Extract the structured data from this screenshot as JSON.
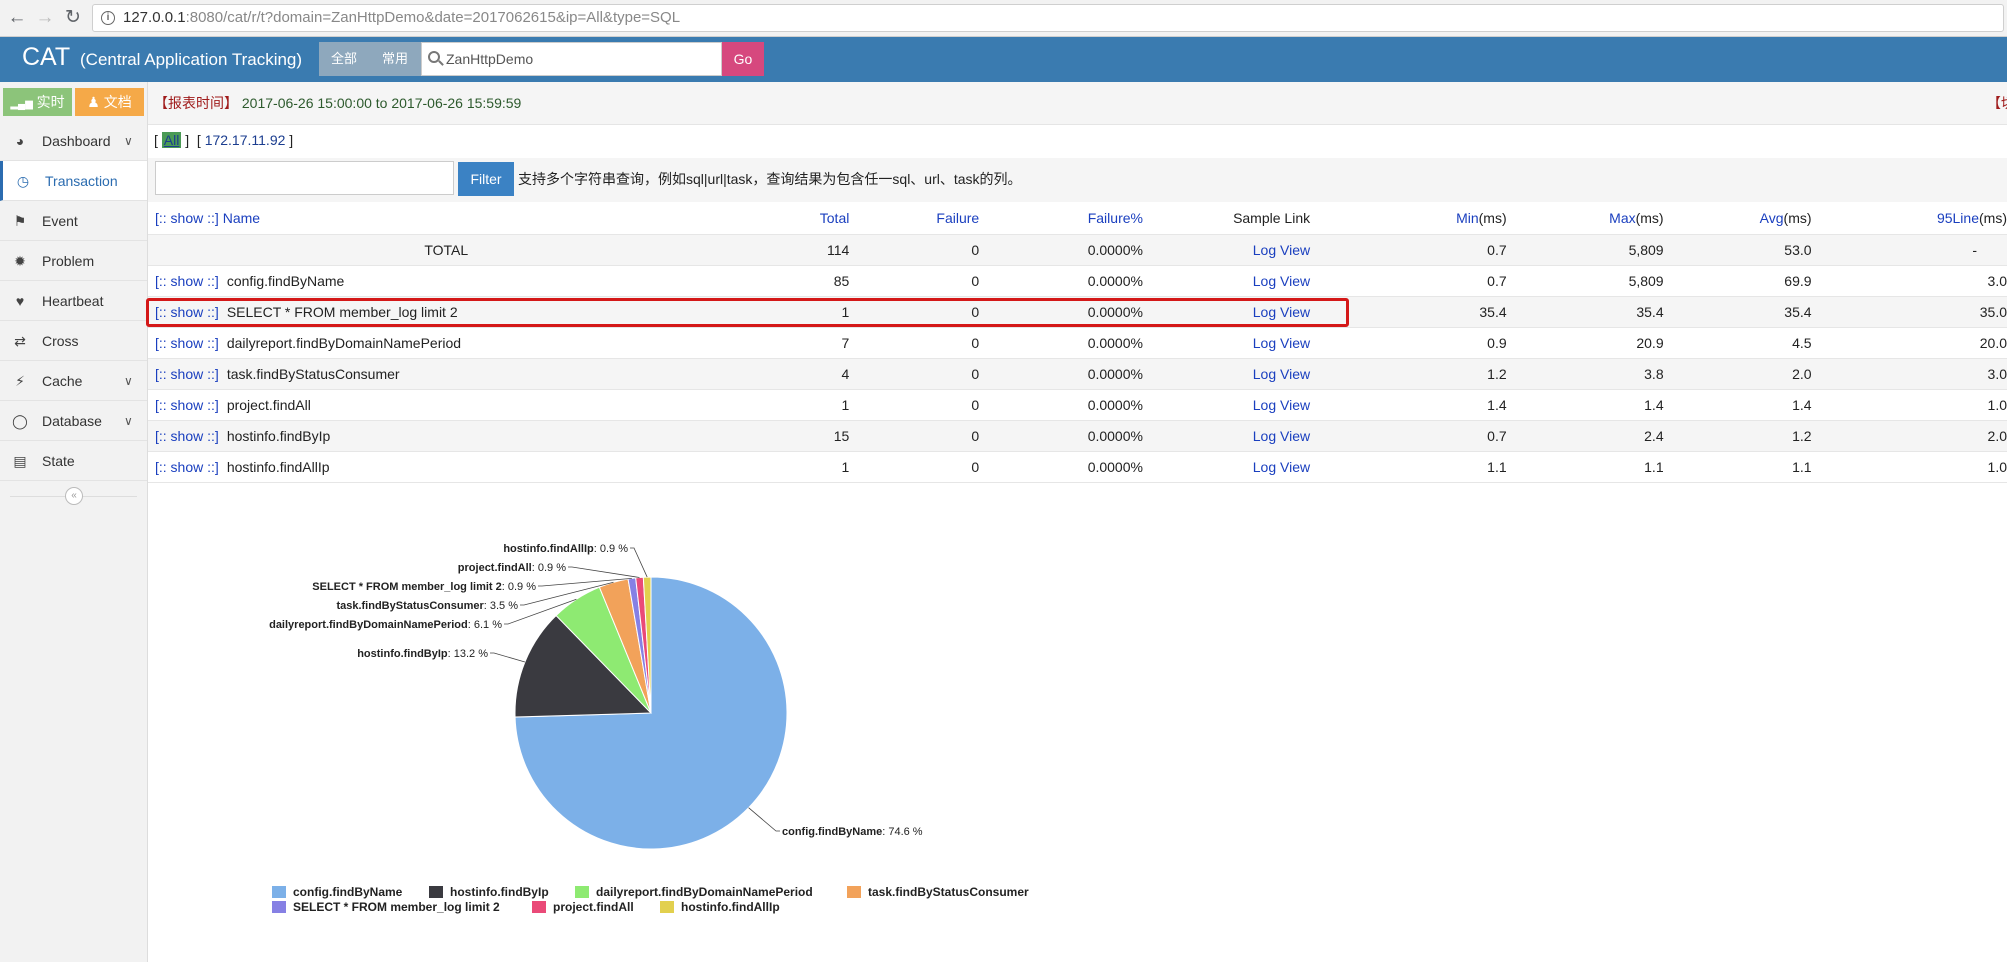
{
  "browser": {
    "url_host": "127.0.0.1",
    "url_rest": ":8080/cat/r/t?domain=ZanHttpDemo&date=2017062615&ip=All&type=SQL"
  },
  "header": {
    "brand": "CAT",
    "brand_sub": "(Central Application Tracking)",
    "tab_all": "全部",
    "tab_common": "常用",
    "search_value": "ZanHttpDemo",
    "go_label": "Go"
  },
  "sidebar": {
    "realtime_label": "实时",
    "docs_label": "文档",
    "items": [
      {
        "label": "Dashboard",
        "icon": "tachometer-icon",
        "has_chevron": true
      },
      {
        "label": "Transaction",
        "icon": "clock-icon",
        "active": true
      },
      {
        "label": "Event",
        "icon": "flag-icon"
      },
      {
        "label": "Problem",
        "icon": "bug-icon"
      },
      {
        "label": "Heartbeat",
        "icon": "heart-icon"
      },
      {
        "label": "Cross",
        "icon": "shuffle-icon"
      },
      {
        "label": "Cache",
        "icon": "bolt-icon",
        "has_chevron": true
      },
      {
        "label": "Database",
        "icon": "database-icon",
        "has_chevron": true
      },
      {
        "label": "State",
        "icon": "bar-chart-icon"
      }
    ]
  },
  "report": {
    "time_label": "【报表时间】",
    "time_range": "2017-06-26 15:00:00 to 2017-06-26 15:59:59",
    "switch_label": "【切"
  },
  "ip_filter": {
    "all": "All",
    "ip": "172.17.11.92"
  },
  "filter": {
    "button": "Filter",
    "hint": "支持多个字符串查询，例如sql|url|task，查询结果为包含任一sql、url、task的列。"
  },
  "table": {
    "headers": {
      "show": "[:: show ::]",
      "name": "Name",
      "total": "Total",
      "failure": "Failure",
      "failure_pct": "Failure%",
      "sample_link": "Sample Link",
      "min": "Min",
      "max": "Max",
      "avg": "Avg",
      "line95": "95Line",
      "unit": "(ms)"
    },
    "total_row": {
      "name": "TOTAL",
      "total": "114",
      "failure": "0",
      "failure_pct": "0.0000%",
      "link": "Log View",
      "min": "0.7",
      "max": "5,809",
      "avg": "53.0",
      "line95": "-"
    },
    "rows": [
      {
        "show": "[:: show ::]",
        "name": "config.findByName",
        "total": "85",
        "failure": "0",
        "failure_pct": "0.0000%",
        "link": "Log View",
        "min": "0.7",
        "max": "5,809",
        "avg": "69.9",
        "line95": "3.0"
      },
      {
        "show": "[:: show ::]",
        "name": "SELECT * FROM member_log limit 2",
        "total": "1",
        "failure": "0",
        "failure_pct": "0.0000%",
        "link": "Log View",
        "min": "35.4",
        "max": "35.4",
        "avg": "35.4",
        "line95": "35.0"
      },
      {
        "show": "[:: show ::]",
        "name": "dailyreport.findByDomainNamePeriod",
        "total": "7",
        "failure": "0",
        "failure_pct": "0.0000%",
        "link": "Log View",
        "min": "0.9",
        "max": "20.9",
        "avg": "4.5",
        "line95": "20.0"
      },
      {
        "show": "[:: show ::]",
        "name": "task.findByStatusConsumer",
        "total": "4",
        "failure": "0",
        "failure_pct": "0.0000%",
        "link": "Log View",
        "min": "1.2",
        "max": "3.8",
        "avg": "2.0",
        "line95": "3.0"
      },
      {
        "show": "[:: show ::]",
        "name": "project.findAll",
        "total": "1",
        "failure": "0",
        "failure_pct": "0.0000%",
        "link": "Log View",
        "min": "1.4",
        "max": "1.4",
        "avg": "1.4",
        "line95": "1.0"
      },
      {
        "show": "[:: show ::]",
        "name": "hostinfo.findByIp",
        "total": "15",
        "failure": "0",
        "failure_pct": "0.0000%",
        "link": "Log View",
        "min": "0.7",
        "max": "2.4",
        "avg": "1.2",
        "line95": "2.0"
      },
      {
        "show": "[:: show ::]",
        "name": "hostinfo.findAllIp",
        "total": "1",
        "failure": "0",
        "failure_pct": "0.0000%",
        "link": "Log View",
        "min": "1.1",
        "max": "1.1",
        "avg": "1.1",
        "line95": "1.0"
      }
    ]
  },
  "chart_data": {
    "type": "pie",
    "slices": [
      {
        "name": "config.findByName",
        "value": 74.6,
        "label": "74.6 %",
        "color": "#7cb0e8"
      },
      {
        "name": "hostinfo.findByIp",
        "value": 13.2,
        "label": "13.2 %",
        "color": "#3a3a40"
      },
      {
        "name": "dailyreport.findByDomainNamePeriod",
        "value": 6.1,
        "label": "6.1 %",
        "color": "#8eea72"
      },
      {
        "name": "task.findByStatusConsumer",
        "value": 3.5,
        "label": "3.5 %",
        "color": "#f2a25a"
      },
      {
        "name": "SELECT * FROM member_log limit 2",
        "value": 0.9,
        "label": "0.9 %",
        "color": "#8680e4"
      },
      {
        "name": "project.findAll",
        "value": 0.9,
        "label": "0.9 %",
        "color": "#ea4a78"
      },
      {
        "name": "hostinfo.findAllIp",
        "value": 0.9,
        "label": "0.9 %",
        "color": "#e2d04e"
      }
    ],
    "legend_position": "bottom"
  }
}
